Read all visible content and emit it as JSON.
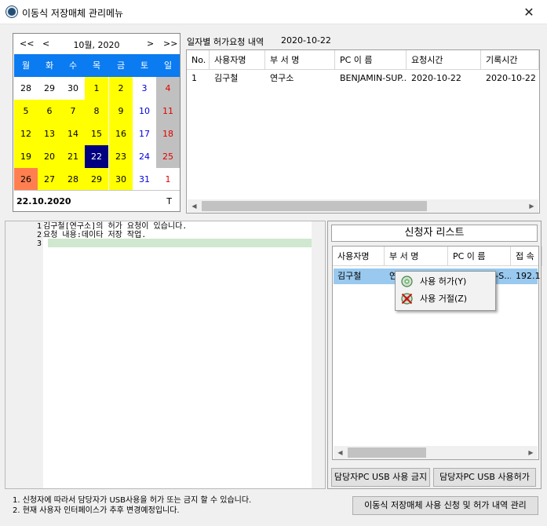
{
  "window": {
    "title": "이동식 저장매체 관리메뉴",
    "close_glyph": "✕"
  },
  "calendar": {
    "prev_year": "<<",
    "prev_month": "<",
    "next_month": ">",
    "next_year": ">>",
    "month_label": "10월, 2020",
    "weekdays": [
      "월",
      "화",
      "수",
      "목",
      "금",
      "토",
      "일"
    ],
    "weeks": [
      [
        "28",
        "29",
        "30",
        "1",
        "2",
        "3",
        "4"
      ],
      [
        "5",
        "6",
        "7",
        "8",
        "9",
        "10",
        "11"
      ],
      [
        "12",
        "13",
        "14",
        "15",
        "16",
        "17",
        "18"
      ],
      [
        "19",
        "20",
        "21",
        "22",
        "23",
        "24",
        "25"
      ],
      [
        "26",
        "27",
        "28",
        "29",
        "30",
        "31",
        "1"
      ]
    ],
    "selected_day": "22",
    "today_label": "22.10.2020",
    "today_shortcut": "T",
    "colors": {
      "header": "#0a7bf0",
      "highlight": "#ffff00",
      "selected": "#000080",
      "weekend": "#c0c0c0",
      "other": "#ff7f50",
      "sunday_text": "#e00000",
      "saturday_text": "#0000e0"
    }
  },
  "requests": {
    "date_label": "일자별 허가요청 내역",
    "date_value": "2020-10-22",
    "columns": [
      "No.",
      "사용자명",
      "부 서 명",
      "PC 이 름",
      "요청시간",
      "기록시간"
    ],
    "rows": [
      [
        "1",
        "김구철",
        "연구소",
        "BENJAMIN-SUP...",
        "2020-10-22",
        "2020-10-22"
      ]
    ]
  },
  "editor": {
    "lines": [
      {
        "num": "1",
        "text": "김구철[연구소]의 허가 요청이 있습니다."
      },
      {
        "num": "2",
        "text": "요청 내용:데이타 저장 작업."
      },
      {
        "num": "3",
        "text": ""
      }
    ]
  },
  "applicants": {
    "title": "신청자 리스트",
    "columns": [
      "사용자명",
      "부 서 명",
      "PC 이 름",
      "접 속"
    ],
    "rows": [
      [
        "김구철",
        "연구소",
        "BENJAMIN-S...",
        "192.1"
      ]
    ],
    "deny_button": "담당자PC USB 사용 금지",
    "allow_button": "담당자PC USB 사용허가"
  },
  "context_menu": {
    "items": [
      {
        "label": "사용 허가(Y)",
        "icon": "cd-disc-icon"
      },
      {
        "label": "사용 거절(Z)",
        "icon": "denied-disc-icon"
      }
    ]
  },
  "footer": {
    "notes": [
      "1. 신청자에 따라서 담당자가 USB사용을 허가 또는 금지 할 수 있습니다.",
      "2. 현재 사용자 인터페이스가 추후 변경예정입니다."
    ],
    "manage_button": "이동식 저장매체 사용 신청 및 허가 내역 관리"
  }
}
